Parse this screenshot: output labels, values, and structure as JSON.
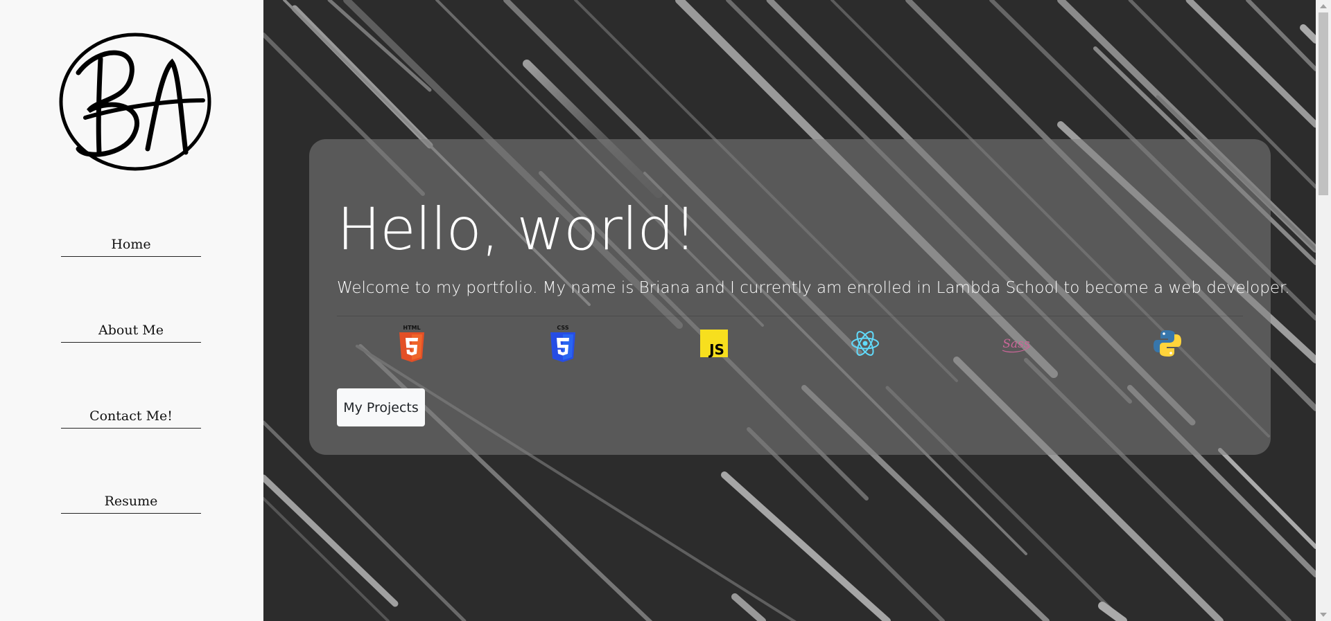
{
  "sidebar": {
    "logo_text": "BA",
    "nav": [
      {
        "label": "Home"
      },
      {
        "label": "About Me"
      },
      {
        "label": "Contact Me!"
      },
      {
        "label": "Resume"
      }
    ]
  },
  "hero": {
    "title": "Hello, world!",
    "text": "Welcome to my portfolio. My name is Briana and I currently am enrolled in Lambda School to become a web developer.",
    "button": "My Projects"
  },
  "tech_icons": [
    {
      "name": "html5-icon",
      "label": "HTML",
      "color": "#e34f26"
    },
    {
      "name": "css3-icon",
      "label": "CSS",
      "color": "#1572b6"
    },
    {
      "name": "javascript-icon",
      "label": "JS",
      "color": "#f7df1e"
    },
    {
      "name": "react-icon",
      "label": "",
      "color": "#61dafb"
    },
    {
      "name": "sass-icon",
      "label": "Sass",
      "color": "#cc6699"
    },
    {
      "name": "python-icon",
      "label": "",
      "color": "#3776ab"
    }
  ],
  "colors": {
    "sidebar_bg": "#f8f8f8",
    "main_bg": "#2c2c2c",
    "card_bg": "#808080",
    "button_bg": "#f8f9fa"
  }
}
